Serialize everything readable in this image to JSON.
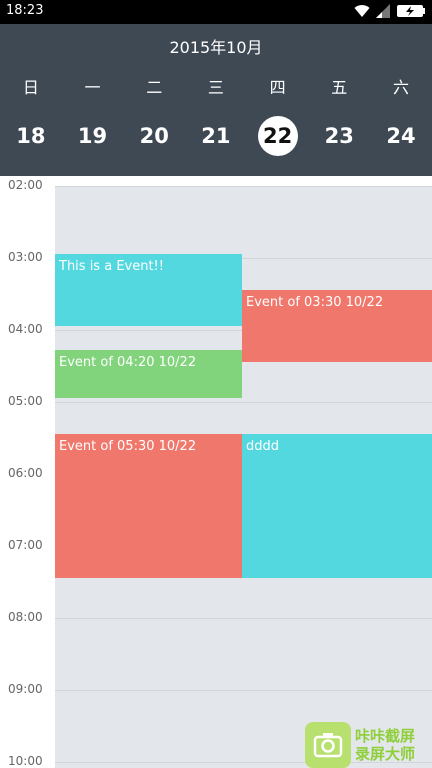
{
  "status_bar": {
    "time": "18:23",
    "icons": [
      "wifi-icon",
      "signal-icon",
      "battery-icon"
    ]
  },
  "header": {
    "month_title": "2015年10月",
    "weekdays": [
      "日",
      "一",
      "二",
      "三",
      "四",
      "五",
      "六"
    ],
    "dates": [
      "18",
      "19",
      "20",
      "21",
      "22",
      "23",
      "24"
    ],
    "selected_date": "22"
  },
  "time_labels": [
    "02:00",
    "03:00",
    "04:00",
    "05:00",
    "06:00",
    "07:00",
    "08:00",
    "09:00",
    "10:00"
  ],
  "events": [
    {
      "title": "This is a Event!!",
      "color": "#54d8e0"
    },
    {
      "title": "Event of 03:30 10/22",
      "color": "#f0776b"
    },
    {
      "title": "Event of 04:20 10/22",
      "color": "#81d47c"
    },
    {
      "title": "Event of 05:30 10/22",
      "color": "#f0776b"
    },
    {
      "title": "dddd",
      "color": "#54d8e0"
    }
  ],
  "watermark": {
    "line1": "咔咔截屏",
    "line2": "录屏大师"
  }
}
